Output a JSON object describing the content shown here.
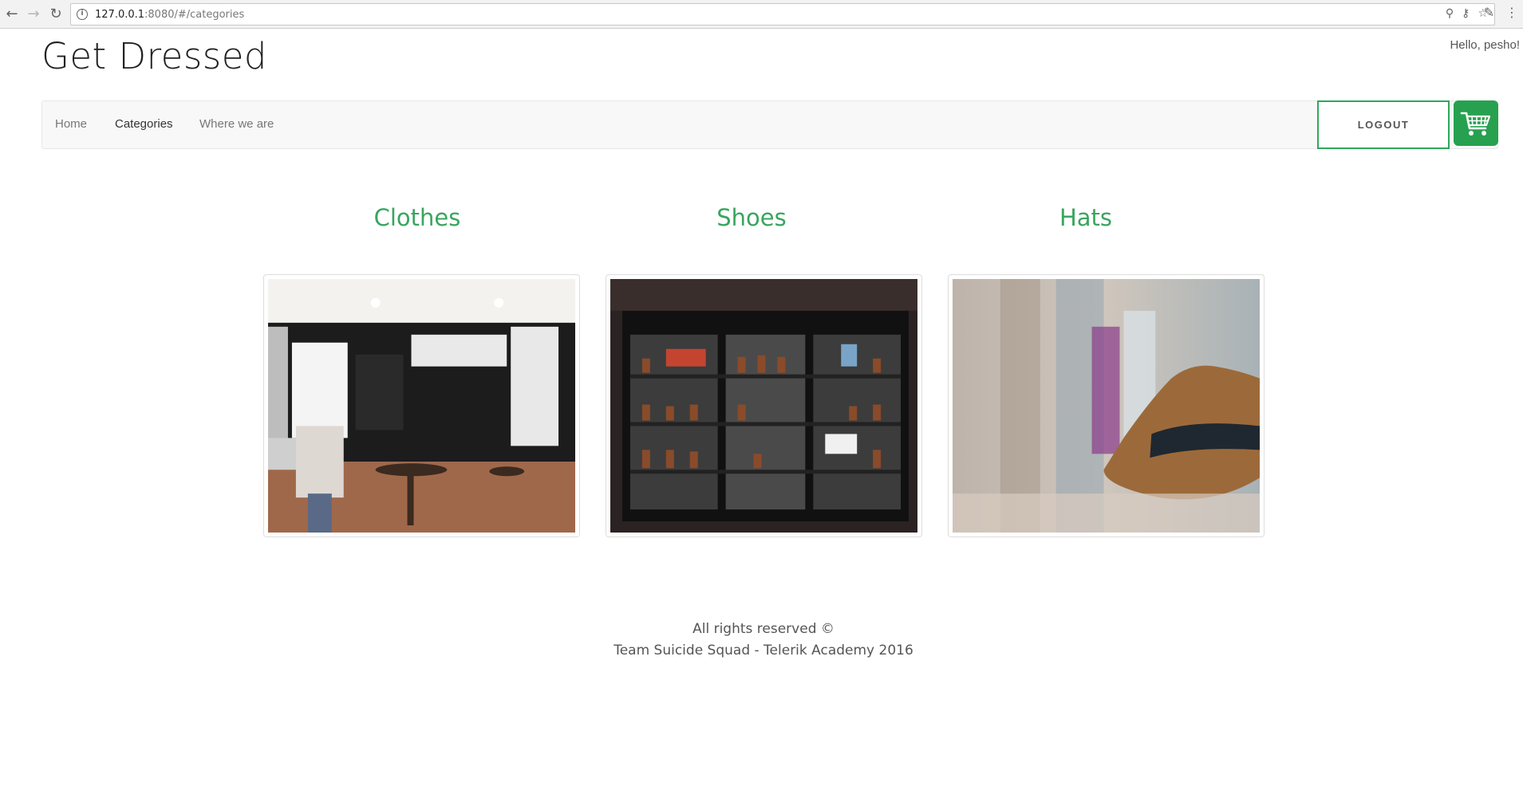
{
  "browser": {
    "url_host": "127.0.0.1",
    "url_rest": ":8080/#/categories"
  },
  "site": {
    "title": "Get Dressed",
    "greeting": "Hello, pesho!"
  },
  "nav": {
    "items": [
      {
        "label": "Home"
      },
      {
        "label": "Categories"
      },
      {
        "label": "Where we are"
      }
    ],
    "logout_label": "LOGOUT",
    "cart_icon": "shopping-cart-icon"
  },
  "categories": [
    {
      "name": "Clothes"
    },
    {
      "name": "Shoes"
    },
    {
      "name": "Hats"
    }
  ],
  "footer": {
    "line1": "All rights reserved ©",
    "line2": "Team Suicide Squad - Telerik Academy 2016"
  },
  "colors": {
    "accent": "#3aa55f",
    "cart": "#27a14f"
  }
}
